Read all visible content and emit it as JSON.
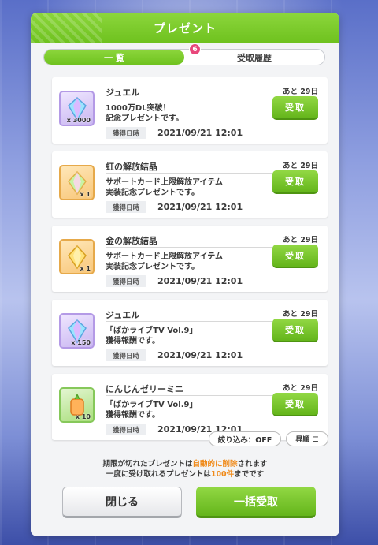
{
  "dialog": {
    "title": "プレゼント"
  },
  "tabs": [
    {
      "label": "一 覧",
      "active": true
    },
    {
      "label": "受取履歴",
      "active": false
    }
  ],
  "tab_badge": "6",
  "items": [
    {
      "name": "ジュエル",
      "desc": "1000万DL突破！\n記念プレゼントです。",
      "date_label": "獲得日時",
      "date": "2021/09/21 12:01",
      "remain": "あと 29日",
      "button": "受取",
      "qty": "x 3000",
      "icon": "jewel-icon"
    },
    {
      "name": "虹の解放結晶",
      "desc": "サポートカード上限解放アイテム\n実装記念プレゼントです。",
      "date_label": "獲得日時",
      "date": "2021/09/21 12:01",
      "remain": "あと 29日",
      "button": "受取",
      "qty": "x 1",
      "icon": "rainbow-crystal-icon"
    },
    {
      "name": "金の解放結晶",
      "desc": "サポートカード上限解放アイテム\n実装記念プレゼントです。",
      "date_label": "獲得日時",
      "date": "2021/09/21 12:01",
      "remain": "あと 29日",
      "button": "受取",
      "qty": "x 1",
      "icon": "gold-crystal-icon"
    },
    {
      "name": "ジュエル",
      "desc": "「ぱかライブTV Vol.9」\n獲得報酬です。",
      "date_label": "獲得日時",
      "date": "2021/09/21 12:01",
      "remain": "あと 29日",
      "button": "受取",
      "qty": "x 150",
      "icon": "jewel-icon"
    },
    {
      "name": "にんじんゼリーミニ",
      "desc": "「ぱかライブTV Vol.9」\n獲得報酬です。",
      "date_label": "獲得日時",
      "date": "2021/09/21 12:01",
      "remain": "あと 29日",
      "button": "受取",
      "qty": "x 10",
      "icon": "carrot-jelly-icon"
    }
  ],
  "filter": {
    "label": "絞り込み：OFF"
  },
  "sort": {
    "label": "昇順 ☰"
  },
  "notice": {
    "line1_a": "期限が切れたプレゼントは",
    "line1_hl": "自動的に削除",
    "line1_b": "されます",
    "line2_a": "一度に受け取れるプレゼントは",
    "line2_hl": "100件",
    "line2_b": "までです"
  },
  "buttons": {
    "close": "閉じる",
    "bulk": "一括受取"
  },
  "colors": {
    "accent": "#6fc21f",
    "badge": "#e8477b",
    "highlight": "#f08a19"
  }
}
